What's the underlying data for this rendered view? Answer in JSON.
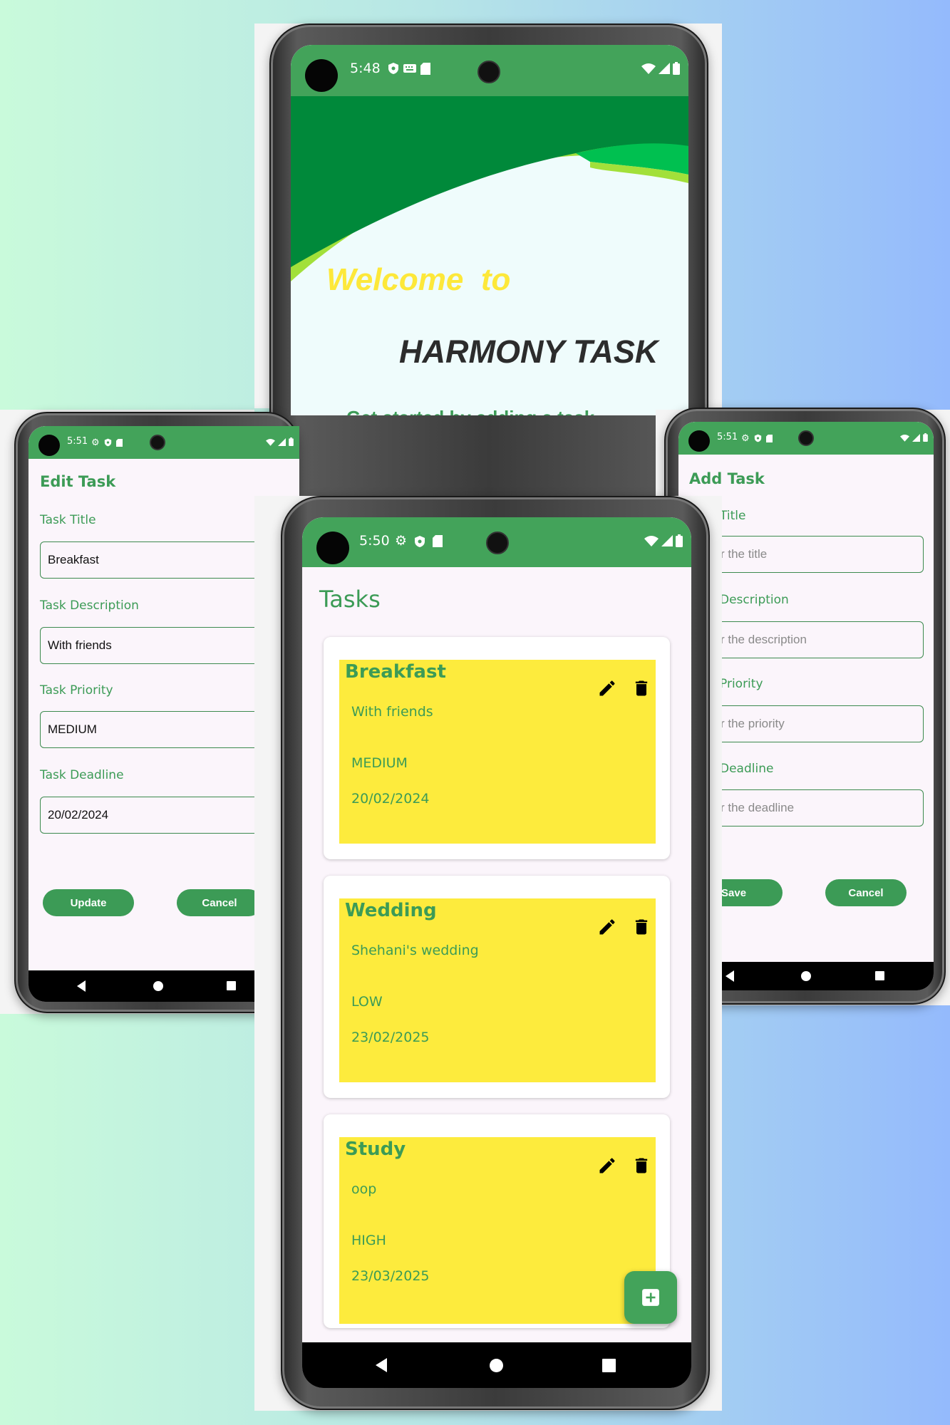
{
  "colors": {
    "primary_green": "#43a35a",
    "accent_text": "#3c9b56",
    "task_yellow": "#fdeb3d",
    "welcome_yellow": "#fde83a"
  },
  "welcome_phone": {
    "status_time": "5:48",
    "welcome_text": "Welcome  to",
    "app_name": "HARMONY TASK",
    "partial_subtitle": "Get started by adding a task"
  },
  "edit_phone": {
    "status_time": "5:51",
    "title": "Edit Task",
    "fields": [
      {
        "label": "Task Title",
        "value": "Breakfast"
      },
      {
        "label": "Task Description",
        "value": "With friends"
      },
      {
        "label": "Task Priority",
        "value": "MEDIUM"
      },
      {
        "label": "Task Deadline",
        "value": "20/02/2024"
      }
    ],
    "update_label": "Update",
    "cancel_label": "Cancel"
  },
  "add_phone": {
    "status_time": "5:51",
    "title": "Add Task",
    "fields": [
      {
        "label": "Title",
        "placeholder": "r the title"
      },
      {
        "label": "Description",
        "placeholder": "r the description"
      },
      {
        "label": "Priority",
        "placeholder": "r the priority"
      },
      {
        "label": "Deadline",
        "placeholder": "r the deadline"
      }
    ],
    "save_label": "Save",
    "cancel_label": "Cancel"
  },
  "tasks_phone": {
    "status_time": "5:50",
    "title": "Tasks",
    "tasks": [
      {
        "title": "Breakfast",
        "description": "With friends",
        "priority": "MEDIUM",
        "deadline": "20/02/2024"
      },
      {
        "title": "Wedding",
        "description": "Shehani's wedding",
        "priority": "LOW",
        "deadline": "23/02/2025"
      },
      {
        "title": "Study",
        "description": "oop",
        "priority": "HIGH",
        "deadline": "23/03/2025"
      }
    ]
  },
  "icons": [
    "edit-icon",
    "delete-icon",
    "add-icon",
    "gear-icon",
    "shield-icon",
    "sd-card-icon",
    "wifi-icon",
    "signal-icon",
    "battery-icon",
    "keyboard-icon"
  ]
}
